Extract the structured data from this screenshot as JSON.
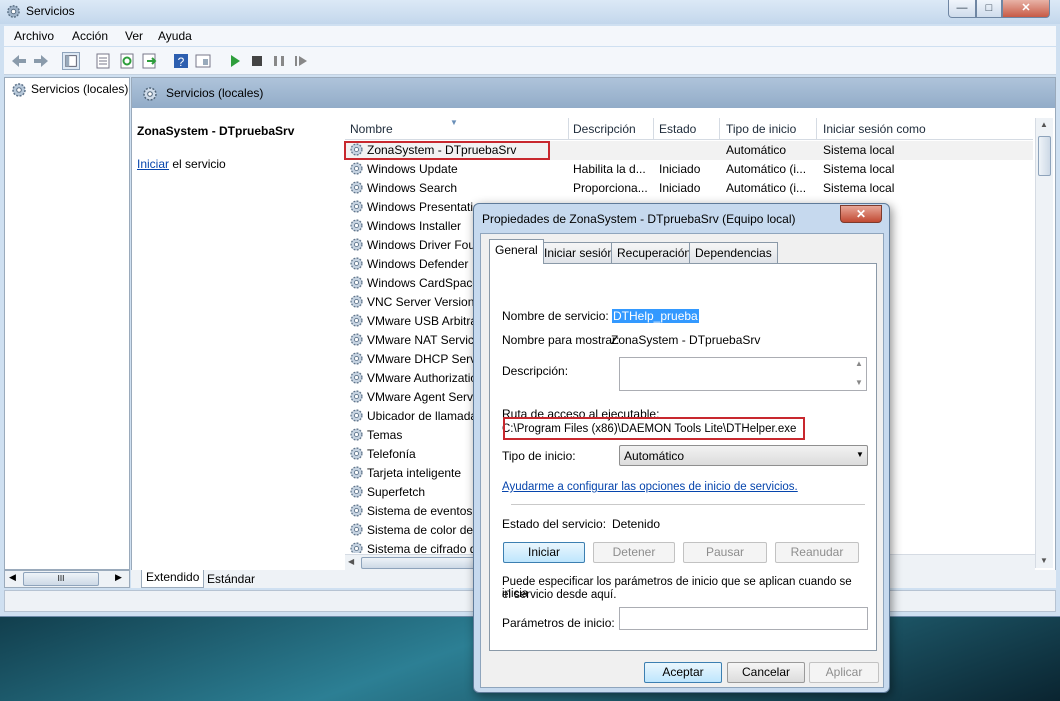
{
  "window": {
    "title": "Servicios",
    "minimize": "—",
    "maximize": "□",
    "close": "✕"
  },
  "menu": [
    "Archivo",
    "Acción",
    "Ver",
    "Ayuda"
  ],
  "tree": {
    "root": "Servicios (locales)",
    "hscroll_grip": "III"
  },
  "content": {
    "header_title": "Servicios (locales)",
    "detail_title": "ZonaSystem - DTpruebaSrv",
    "start_link": "Iniciar",
    "start_suffix": " el servicio"
  },
  "columns": [
    "Nombre",
    "Descripción",
    "Estado",
    "Tipo de inicio",
    "Iniciar sesión como"
  ],
  "services": [
    {
      "name": "ZonaSystem - DTpruebaSrv",
      "desc": "",
      "state": "",
      "type": "Automático",
      "logon": "Sistema local"
    },
    {
      "name": "Windows Update",
      "desc": "Habilita la d...",
      "state": "Iniciado",
      "type": "Automático (i...",
      "logon": "Sistema local"
    },
    {
      "name": "Windows Search",
      "desc": "Proporciona...",
      "state": "Iniciado",
      "type": "Automático (i...",
      "logon": "Sistema local"
    },
    {
      "name": "Windows Presentation",
      "desc": "",
      "state": "",
      "type": "",
      "logon": ""
    },
    {
      "name": "Windows Installer",
      "desc": "",
      "state": "",
      "type": "",
      "logon": ""
    },
    {
      "name": "Windows Driver Foundation",
      "desc": "",
      "state": "",
      "type": "",
      "logon": ""
    },
    {
      "name": "Windows Defender",
      "desc": "",
      "state": "",
      "type": "",
      "logon": ""
    },
    {
      "name": "Windows CardSpace",
      "desc": "",
      "state": "",
      "type": "",
      "logon": ""
    },
    {
      "name": "VNC Server Version 4",
      "desc": "",
      "state": "",
      "type": "",
      "logon": ""
    },
    {
      "name": "VMware USB Arbitration",
      "desc": "",
      "state": "",
      "type": "",
      "logon": ""
    },
    {
      "name": "VMware NAT Service",
      "desc": "",
      "state": "",
      "type": "",
      "logon": ""
    },
    {
      "name": "VMware DHCP Service",
      "desc": "",
      "state": "",
      "type": "",
      "logon": ""
    },
    {
      "name": "VMware Authorization",
      "desc": "",
      "state": "",
      "type": "",
      "logon": ""
    },
    {
      "name": "VMware Agent Service",
      "desc": "",
      "state": "",
      "type": "",
      "logon": ""
    },
    {
      "name": "Ubicador de llamadas",
      "desc": "",
      "state": "",
      "type": "",
      "logon": "d"
    },
    {
      "name": "Temas",
      "desc": "",
      "state": "",
      "type": "",
      "logon": ""
    },
    {
      "name": "Telefonía",
      "desc": "",
      "state": "",
      "type": "",
      "logon": "d"
    },
    {
      "name": "Tarjeta inteligente",
      "desc": "",
      "state": "",
      "type": "",
      "logon": ""
    },
    {
      "name": "Superfetch",
      "desc": "",
      "state": "",
      "type": "",
      "logon": ""
    },
    {
      "name": "Sistema de eventos COM+",
      "desc": "",
      "state": "",
      "type": "",
      "logon": ""
    },
    {
      "name": "Sistema de color de Windows",
      "desc": "",
      "state": "",
      "type": "",
      "logon": ""
    },
    {
      "name": "Sistema de cifrado de archivos",
      "desc": "",
      "state": "",
      "type": "",
      "logon": ""
    }
  ],
  "bottom_tabs": [
    "Extendido",
    "Estándar"
  ],
  "dialog": {
    "title": "Propiedades de ZonaSystem - DTpruebaSrv (Equipo local)",
    "close": "✕",
    "tabs": [
      "General",
      "Iniciar sesión",
      "Recuperación",
      "Dependencias"
    ],
    "service_name_label": "Nombre de servicio:",
    "service_name_value": "DTHelp_prueba",
    "display_name_label": "Nombre para mostrar:",
    "display_name_value": "ZonaSystem - DTpruebaSrv",
    "description_label": "Descripción:",
    "path_label": "Ruta de acceso al ejecutable:",
    "path_value": "C:\\Program Files (x86)\\DAEMON Tools Lite\\DTHelper.exe",
    "start_type_label": "Tipo de inicio:",
    "start_type_value": "Automático",
    "help_link": "Ayudarme a configurar las opciones de inicio de servicios.",
    "status_label": "Estado del servicio:",
    "status_value": "Detenido",
    "buttons": {
      "start": "Iniciar",
      "stop": "Detener",
      "pause": "Pausar",
      "resume": "Reanudar"
    },
    "params_info_1": "Puede especificar los parámetros de inicio que se aplican cuando se inicia",
    "params_info_2": "el servicio desde aquí.",
    "params_label": "Parámetros de inicio:",
    "ok": "Aceptar",
    "cancel": "Cancelar",
    "apply": "Aplicar"
  },
  "colors": {
    "accent": "#3399ff",
    "highlight_border": "#c8282e",
    "link": "#0645ad"
  }
}
